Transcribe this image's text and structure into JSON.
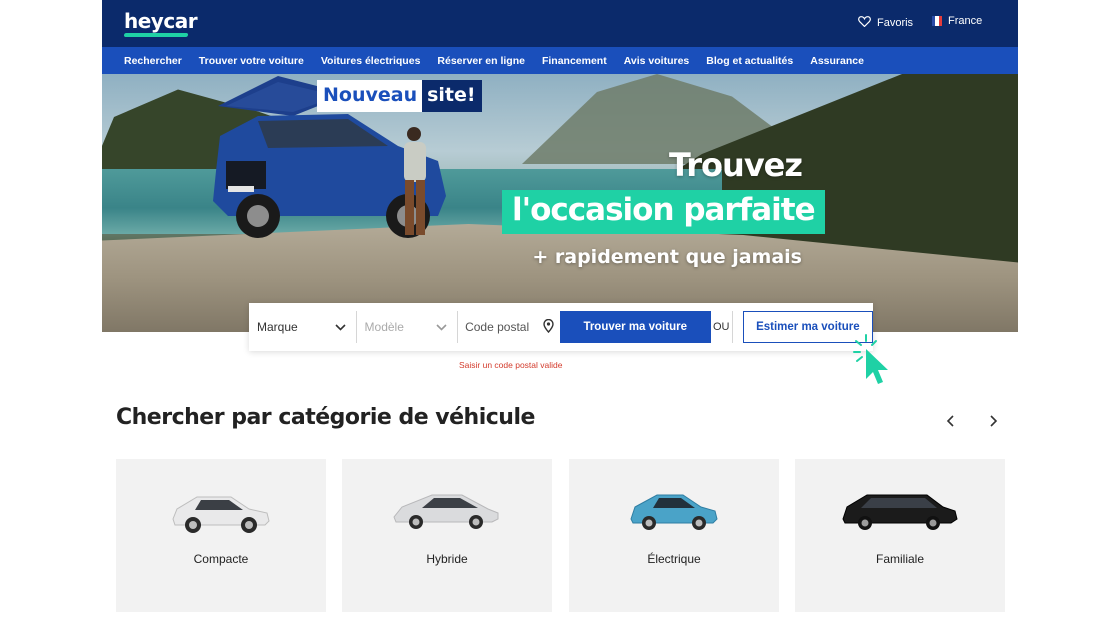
{
  "header": {
    "logo": "heycar",
    "favorites_label": "Favoris",
    "country_label": "France"
  },
  "nav": {
    "items": [
      "Rechercher",
      "Trouver votre voiture",
      "Voitures électriques",
      "Réserver en ligne",
      "Financement",
      "Avis voitures",
      "Blog et actualités",
      "Assurance"
    ]
  },
  "hero": {
    "badge_part1": "Nouveau",
    "badge_part2": "site!",
    "line1": "Trouvez",
    "line2": "l'occasion parfaite",
    "line3": "+ rapidement que jamais"
  },
  "search": {
    "make_label": "Marque",
    "model_label": "Modèle",
    "postal_label": "Code postal",
    "find_button": "Trouver ma voiture",
    "or_label": "OU",
    "estimate_button": "Estimer ma voiture",
    "error": "Saisir un code postal valide"
  },
  "categories": {
    "title": "Chercher par catégorie de véhicule",
    "items": [
      {
        "label": "Compacte",
        "color": "#e8e8e8"
      },
      {
        "label": "Hybride",
        "color": "#d9dadc"
      },
      {
        "label": "Électrique",
        "color": "#4aa3c8"
      },
      {
        "label": "Familiale",
        "color": "#1b1b1b"
      }
    ]
  },
  "colors": {
    "brand_dark": "#0b2a6b",
    "brand_blue": "#1a4fbb",
    "accent_green": "#1fd1a5",
    "error_red": "#d33b2c"
  }
}
